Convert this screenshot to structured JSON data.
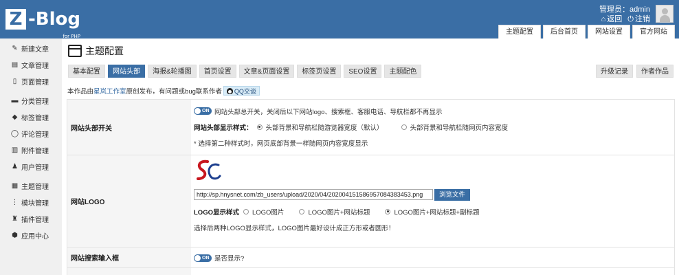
{
  "header": {
    "logo_letter": "Z",
    "logo_text": "-Blog",
    "logo_sub": "for PHP",
    "user_label": "管理员：admin",
    "back_label": "返回",
    "logout_label": "注销",
    "tabs": [
      "主题配置",
      "后台首页",
      "网站设置",
      "官方网站"
    ],
    "color": "#3a6ea5"
  },
  "sidebar": {
    "items": [
      {
        "label": "新建文章",
        "icon": "edit-icon"
      },
      {
        "label": "文章管理",
        "icon": "document-icon"
      },
      {
        "label": "页面管理",
        "icon": "page-icon"
      },
      {
        "label": "分类管理",
        "icon": "folder-icon"
      },
      {
        "label": "标签管理",
        "icon": "tag-icon"
      },
      {
        "label": "评论管理",
        "icon": "comment-icon"
      },
      {
        "label": "附件管理",
        "icon": "attachment-icon"
      },
      {
        "label": "用户管理",
        "icon": "user-icon"
      },
      {
        "label": "主题管理",
        "icon": "theme-icon"
      },
      {
        "label": "模块管理",
        "icon": "module-icon"
      },
      {
        "label": "插件管理",
        "icon": "plugin-icon"
      },
      {
        "label": "应用中心",
        "icon": "app-center-icon"
      }
    ]
  },
  "main": {
    "title": "主题配置",
    "tabs": [
      {
        "label": "基本配置",
        "active": false
      },
      {
        "label": "网站头部",
        "active": true
      },
      {
        "label": "海报&轮播图",
        "active": false
      },
      {
        "label": "首页设置",
        "active": false
      },
      {
        "label": "文章&页面设置",
        "active": false
      },
      {
        "label": "标签页设置",
        "active": false
      },
      {
        "label": "SEO设置",
        "active": false
      },
      {
        "label": "主题配色",
        "active": false
      }
    ],
    "right_tabs": [
      "升级记录",
      "作者作品"
    ],
    "note_prefix": "本作品由",
    "note_link": "星岚工作室",
    "note_suffix": "原创发布，有问题或bug联系作者",
    "qq_label": "QQ交谈"
  },
  "form": {
    "header_row": {
      "label": "网站头部开关",
      "toggle_text": "ON",
      "switch_desc": "网站头部总开关，关闭后以下网站logo、搜索框、客服电话、导航栏都不再显示",
      "style_label": "网站头部显示样式：",
      "option1": "头部背景和导航栏随游览器宽度（默认）",
      "option2": "头部背景和导航栏随网页内容宽度",
      "hint": "* 选择第二种样式时，网页底部背景一样随网页内容宽度显示"
    },
    "logo_row": {
      "label": "网站LOGO",
      "url": "http://sp.hnysnet.com/zb_users/upload/2020/04/202004151586957084383453.png",
      "browse_button": "浏览文件",
      "style_label": "LOGO显示样式",
      "option1": "LOGO图片",
      "option2": "LOGO图片+网站标题",
      "option3": "LOGO图片+网站标题+副标题",
      "hint": "选择后两种LOGO显示样式，LOGO图片最好设计成正方形或者圆形！"
    },
    "search_row": {
      "label": "网站搜索输入框",
      "toggle_text": "ON",
      "desc": "是否显示?"
    }
  }
}
